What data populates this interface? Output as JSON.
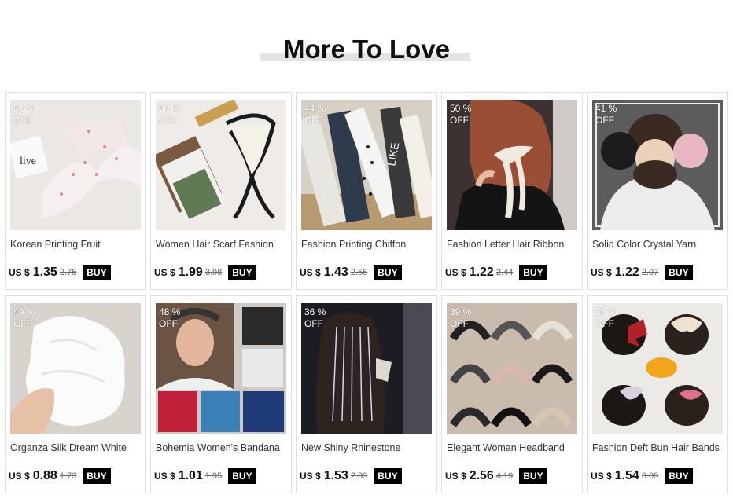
{
  "section_title": "More To Love",
  "buy_label": "BUY",
  "currency": "US $",
  "off_label": "OFF",
  "products": [
    {
      "name": "Korean Printing Fruit",
      "price": "1.35",
      "old_price": "2.75",
      "discount": "51 %"
    },
    {
      "name": "Women Hair Scarf Fashion",
      "price": "1.99",
      "old_price": "3.98",
      "discount": "50 %"
    },
    {
      "name": "Fashion Printing Chiffon",
      "price": "1.43",
      "old_price": "2.55",
      "discount": "44 %"
    },
    {
      "name": "Fashion Letter Hair Ribbon",
      "price": "1.22",
      "old_price": "2.44",
      "discount": "50 %"
    },
    {
      "name": "Solid Color Crystal Yarn",
      "price": "1.22",
      "old_price": "2.07",
      "discount": "41 %"
    },
    {
      "name": "Organza Silk Dream White",
      "price": "0.88",
      "old_price": "1.73",
      "discount": "49 %"
    },
    {
      "name": "Bohemia Women's Bandana",
      "price": "1.01",
      "old_price": "1.95",
      "discount": "48 %"
    },
    {
      "name": "New Shiny Rhinestone",
      "price": "1.53",
      "old_price": "2.39",
      "discount": "36 %"
    },
    {
      "name": "Elegant Woman Headband",
      "price": "2.56",
      "old_price": "4.19",
      "discount": "39 %"
    },
    {
      "name": "Fashion Deft Bun Hair Bands",
      "price": "1.54",
      "old_price": "3.09",
      "discount": "50 %"
    }
  ],
  "image_colors": [
    "#e9e6e2",
    "#ece9e6",
    "#cfc8bc",
    "#3a3130",
    "#5a5a5a",
    "#d8d2cc",
    "#c9c4c0",
    "#1f1f24",
    "#c8b8a8",
    "#ecebe9"
  ]
}
